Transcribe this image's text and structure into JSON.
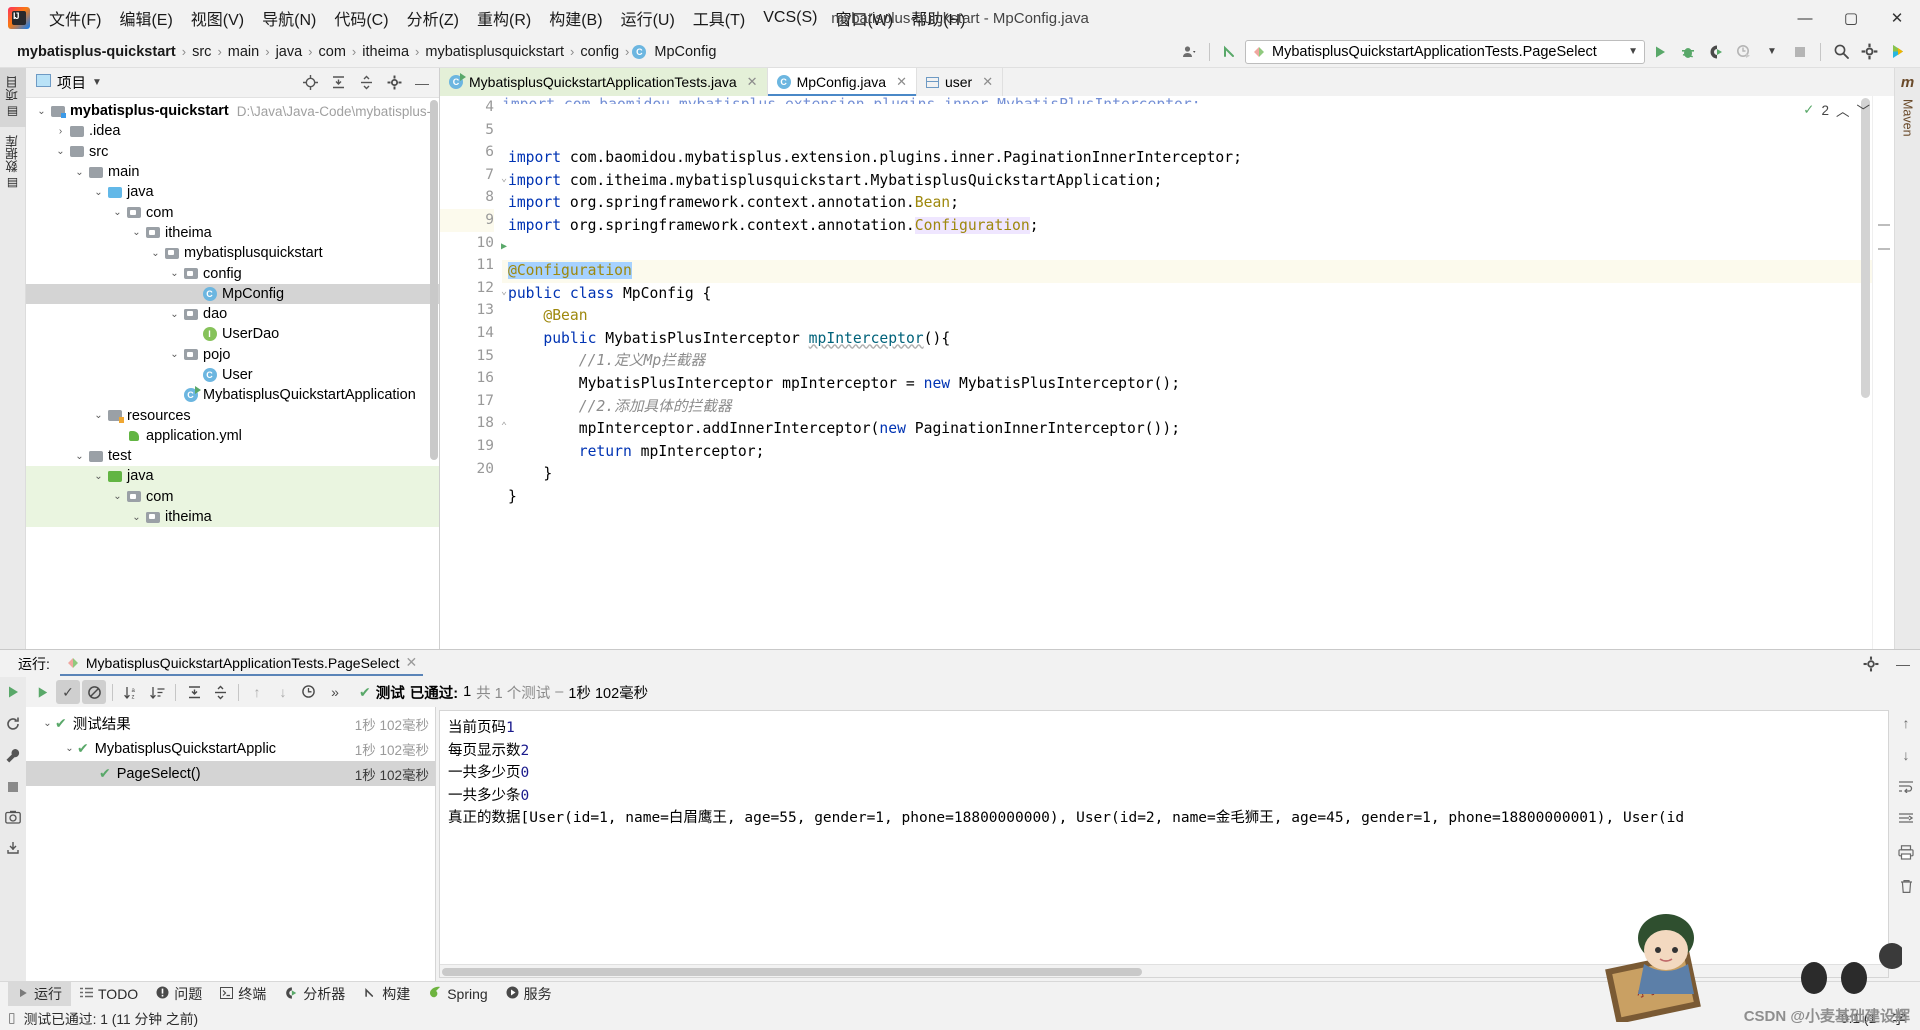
{
  "window": {
    "title": "mybatisplus-quickstart - MpConfig.java",
    "minimize": "—",
    "maximize": "▢",
    "close": "✕"
  },
  "menu": {
    "items": [
      "文件(F)",
      "编辑(E)",
      "视图(V)",
      "导航(N)",
      "代码(C)",
      "分析(Z)",
      "重构(R)",
      "构建(B)",
      "运行(U)",
      "工具(T)",
      "VCS(S)",
      "窗口(W)",
      "帮助(H)"
    ]
  },
  "navbar": {
    "crumbs": [
      "mybatisplus-quickstart",
      "src",
      "main",
      "java",
      "com",
      "itheima",
      "mybatisplusquickstart",
      "config",
      "MpConfig"
    ],
    "separator": "›",
    "run_config": "MybatisplusQuickstartApplicationTests.PageSelect",
    "icons": [
      "user-icon",
      "vcs-update-icon",
      "run-icon",
      "debug-icon",
      "coverage-icon",
      "profile-icon",
      "stop-icon",
      "search-icon",
      "settings-icon",
      "help-assistant-icon"
    ]
  },
  "left_rail": {
    "tabs": [
      "项目",
      "数据库"
    ]
  },
  "right_rail": {
    "tabs": [
      "Maven"
    ]
  },
  "project": {
    "title": "项目",
    "header_icons": [
      "locate-icon",
      "expand-all-icon",
      "collapse-all-icon",
      "gear-icon",
      "hide-icon"
    ],
    "tree": [
      {
        "label": "mybatisplus-quickstart",
        "path": "D:\\Java\\Java-Code\\mybatisplus-qu",
        "indent": 0,
        "twist": "v",
        "icon": "module-folder",
        "bold": true,
        "state": ""
      },
      {
        "label": ".idea",
        "path": "",
        "indent": 1,
        "twist": ">",
        "icon": "folder",
        "bold": false,
        "state": ""
      },
      {
        "label": "src",
        "path": "",
        "indent": 1,
        "twist": "v",
        "icon": "folder",
        "bold": false,
        "state": ""
      },
      {
        "label": "main",
        "path": "",
        "indent": 2,
        "twist": "v",
        "icon": "folder",
        "bold": false,
        "state": ""
      },
      {
        "label": "java",
        "path": "",
        "indent": 3,
        "twist": "v",
        "icon": "source-folder",
        "bold": false,
        "state": ""
      },
      {
        "label": "com",
        "path": "",
        "indent": 4,
        "twist": "v",
        "icon": "package",
        "bold": false,
        "state": ""
      },
      {
        "label": "itheima",
        "path": "",
        "indent": 5,
        "twist": "v",
        "icon": "package",
        "bold": false,
        "state": ""
      },
      {
        "label": "mybatisplusquickstart",
        "path": "",
        "indent": 6,
        "twist": "v",
        "icon": "package",
        "bold": false,
        "state": ""
      },
      {
        "label": "config",
        "path": "",
        "indent": 7,
        "twist": "v",
        "icon": "package",
        "bold": false,
        "state": ""
      },
      {
        "label": "MpConfig",
        "path": "",
        "indent": 8,
        "twist": "",
        "icon": "class",
        "bold": false,
        "state": "selected"
      },
      {
        "label": "dao",
        "path": "",
        "indent": 7,
        "twist": "v",
        "icon": "package",
        "bold": false,
        "state": ""
      },
      {
        "label": "UserDao",
        "path": "",
        "indent": 8,
        "twist": "",
        "icon": "interface",
        "bold": false,
        "state": ""
      },
      {
        "label": "pojo",
        "path": "",
        "indent": 7,
        "twist": "v",
        "icon": "package",
        "bold": false,
        "state": ""
      },
      {
        "label": "User",
        "path": "",
        "indent": 8,
        "twist": "",
        "icon": "class",
        "bold": false,
        "state": ""
      },
      {
        "label": "MybatisplusQuickstartApplication",
        "path": "",
        "indent": 7,
        "twist": "",
        "icon": "runnable-class",
        "bold": false,
        "state": ""
      },
      {
        "label": "resources",
        "path": "",
        "indent": 3,
        "twist": "v",
        "icon": "resource-folder",
        "bold": false,
        "state": ""
      },
      {
        "label": "application.yml",
        "path": "",
        "indent": 4,
        "twist": "",
        "icon": "yaml-file",
        "bold": false,
        "state": ""
      },
      {
        "label": "test",
        "path": "",
        "indent": 2,
        "twist": "v",
        "icon": "folder",
        "bold": false,
        "state": ""
      },
      {
        "label": "java",
        "path": "",
        "indent": 3,
        "twist": "v",
        "icon": "test-source-folder",
        "bold": false,
        "state": "green"
      },
      {
        "label": "com",
        "path": "",
        "indent": 4,
        "twist": "v",
        "icon": "package",
        "bold": false,
        "state": "green"
      },
      {
        "label": "itheima",
        "path": "",
        "indent": 5,
        "twist": "v",
        "icon": "package",
        "bold": false,
        "state": "green"
      }
    ]
  },
  "editor": {
    "tabs": [
      {
        "label": "MybatisplusQuickstartApplicationTests.java",
        "icon": "runnable-class-icon",
        "state": "green"
      },
      {
        "label": "MpConfig.java",
        "icon": "class-icon",
        "state": "active"
      },
      {
        "label": "user",
        "icon": "table-icon",
        "state": ""
      }
    ],
    "inspection": {
      "count": "2",
      "icon": "checkmark-icon"
    },
    "partial_top_line": "import com.baomidou.mybatisplus.extension.plugins.inner.MybatisPlusInterceptor;",
    "lines": [
      {
        "n": "4",
        "current": false,
        "mark": "",
        "segments": [
          {
            "t": "import ",
            "c": "k"
          },
          {
            "t": "com.baomidou.mybatisplus.extension.plugins.inner.PaginationInnerInterceptor;",
            "c": ""
          }
        ]
      },
      {
        "n": "5",
        "current": false,
        "mark": "",
        "segments": [
          {
            "t": "import ",
            "c": "k"
          },
          {
            "t": "com.itheima.mybatisplusquickstart.MybatisplusQuickstartApplication;",
            "c": ""
          }
        ]
      },
      {
        "n": "6",
        "current": false,
        "mark": "",
        "segments": [
          {
            "t": "import ",
            "c": "k"
          },
          {
            "t": "org.springframework.context.annotation.",
            "c": ""
          },
          {
            "t": "Bean",
            "c": "ann"
          },
          {
            "t": ";",
            "c": ""
          }
        ]
      },
      {
        "n": "7",
        "current": false,
        "mark": "fold",
        "segments": [
          {
            "t": "import ",
            "c": "k"
          },
          {
            "t": "org.springframework.context.annotation.",
            "c": ""
          },
          {
            "t": "Configuration",
            "c": "ann hl-purple"
          },
          {
            "t": ";",
            "c": ""
          }
        ]
      },
      {
        "n": "8",
        "current": false,
        "mark": "",
        "segments": []
      },
      {
        "n": "9",
        "current": true,
        "mark": "",
        "segments": [
          {
            "t": "@Configuration",
            "c": "ann hl-blue"
          }
        ]
      },
      {
        "n": "10",
        "current": false,
        "mark": "run",
        "segments": [
          {
            "t": "public class ",
            "c": "k"
          },
          {
            "t": "MpConfig {",
            "c": ""
          }
        ]
      },
      {
        "n": "11",
        "current": false,
        "mark": "",
        "segments": [
          {
            "t": "    ",
            "c": ""
          },
          {
            "t": "@Bean",
            "c": "ann"
          }
        ]
      },
      {
        "n": "12",
        "current": false,
        "mark": "fold",
        "segments": [
          {
            "t": "    ",
            "c": ""
          },
          {
            "t": "public ",
            "c": "k"
          },
          {
            "t": "MybatisPlusInterceptor ",
            "c": ""
          },
          {
            "t": "mpInterceptor",
            "c": "fn wavy"
          },
          {
            "t": "(){",
            "c": ""
          }
        ]
      },
      {
        "n": "13",
        "current": false,
        "mark": "",
        "segments": [
          {
            "t": "        //1.定义Mp拦截器",
            "c": "cmt"
          }
        ]
      },
      {
        "n": "14",
        "current": false,
        "mark": "",
        "segments": [
          {
            "t": "        MybatisPlusInterceptor mpInterceptor = ",
            "c": ""
          },
          {
            "t": "new ",
            "c": "k"
          },
          {
            "t": "MybatisPlusInterceptor();",
            "c": ""
          }
        ]
      },
      {
        "n": "15",
        "current": false,
        "mark": "",
        "segments": [
          {
            "t": "        //2.添加具体的拦截器",
            "c": "cmt"
          }
        ]
      },
      {
        "n": "16",
        "current": false,
        "mark": "",
        "segments": [
          {
            "t": "        mpInterceptor.addInnerInterceptor(",
            "c": ""
          },
          {
            "t": "new ",
            "c": "k"
          },
          {
            "t": "PaginationInnerInterceptor());",
            "c": ""
          }
        ]
      },
      {
        "n": "17",
        "current": false,
        "mark": "",
        "segments": [
          {
            "t": "        ",
            "c": ""
          },
          {
            "t": "return ",
            "c": "k"
          },
          {
            "t": "mpInterceptor;",
            "c": ""
          }
        ]
      },
      {
        "n": "18",
        "current": false,
        "mark": "fold-end",
        "segments": [
          {
            "t": "    }",
            "c": ""
          }
        ]
      },
      {
        "n": "19",
        "current": false,
        "mark": "",
        "segments": [
          {
            "t": "}",
            "c": ""
          }
        ]
      },
      {
        "n": "20",
        "current": false,
        "mark": "",
        "segments": []
      }
    ]
  },
  "run_window": {
    "label": "运行:",
    "tab_title": "MybatisplusQuickstartApplicationTests.PageSelect",
    "header_icons": [
      "settings-icon",
      "hide-icon"
    ],
    "rail_icons": [
      "rerun-icon",
      "rerun-failed-icon",
      "wrench-icon",
      "stop-icon",
      "screenshot-icon",
      "export-icon"
    ],
    "toolbar_icons": [
      "run-icon",
      "show-passed-icon",
      "show-ignored-icon",
      "sort-alpha-icon",
      "sort-duration-icon",
      "expand-all-icon",
      "collapse-all-icon",
      "prev-icon",
      "next-icon",
      "history-icon",
      "more-icon"
    ],
    "status": {
      "prefix": "测试",
      "passed": "已通过:",
      "count": "1",
      "of": "共 1 个测试",
      "dash": "–",
      "duration": "1秒 102毫秒"
    },
    "tree": [
      {
        "label": "测试结果",
        "time": "1秒 102毫秒",
        "indent": 0,
        "twist": "v",
        "selected": false
      },
      {
        "label": "MybatisplusQuickstartApplic",
        "time": "1秒 102毫秒",
        "indent": 1,
        "twist": "v",
        "selected": false
      },
      {
        "label": "PageSelect()",
        "time": "1秒 102毫秒",
        "indent": 2,
        "twist": "",
        "selected": true
      }
    ],
    "console": [
      [
        {
          "t": "当前页码",
          "c": ""
        },
        {
          "t": "1",
          "c": "num"
        }
      ],
      [
        {
          "t": "每页显示数",
          "c": ""
        },
        {
          "t": "2",
          "c": "num"
        }
      ],
      [
        {
          "t": "一共多少页",
          "c": ""
        },
        {
          "t": "0",
          "c": "num"
        }
      ],
      [
        {
          "t": "一共多少条",
          "c": ""
        },
        {
          "t": "0",
          "c": "num"
        }
      ],
      [
        {
          "t": "真正的数据[User(id=1, name=白眉鹰王, age=55, gender=1, phone=18800000000), User(id=2, name=金毛狮王, age=45, gender=1, phone=18800000001), User(id",
          "c": ""
        }
      ]
    ],
    "console_rail_icons": [
      "scroll-up-icon",
      "scroll-down-icon",
      "soft-wrap-icon",
      "scroll-end-icon",
      "print-icon",
      "clear-icon"
    ]
  },
  "statusbar": {
    "items": [
      {
        "label": "运行",
        "icon": "run-icon",
        "active": true
      },
      {
        "label": "TODO",
        "icon": "todo-icon",
        "active": false
      },
      {
        "label": "问题",
        "icon": "problems-icon",
        "active": false
      },
      {
        "label": "终端",
        "icon": "terminal-icon",
        "active": false
      },
      {
        "label": "分析器",
        "icon": "profiler-icon",
        "active": false
      },
      {
        "label": "构建",
        "icon": "build-icon",
        "active": false
      },
      {
        "label": "Spring",
        "icon": "spring-icon",
        "active": false
      },
      {
        "label": "服务",
        "icon": "services-icon",
        "active": false
      }
    ],
    "message": "测试已通过: 1 (11 分钟 之前)",
    "caret": "9:1 (1",
    "encoding": "字"
  },
  "watermark": "CSDN @小麦基础建设辉"
}
